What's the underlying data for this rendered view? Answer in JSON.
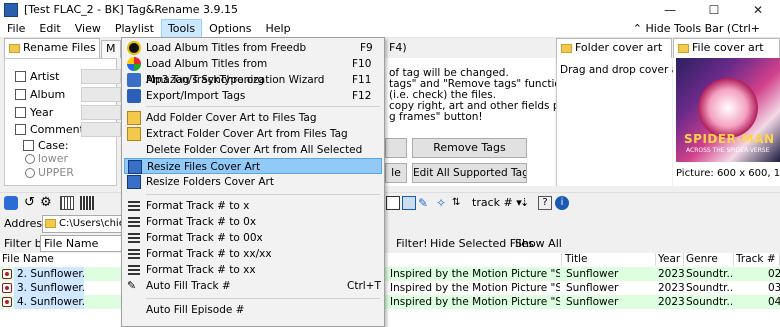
{
  "window": {
    "title": "[Test FLAC_2 - BK] Tag&Rename 3.9.15",
    "minimize": "—",
    "maximize": "☐",
    "close": "✕"
  },
  "menubar": {
    "items": [
      "File",
      "Edit",
      "View",
      "Playlist",
      "Tools",
      "Options",
      "Help"
    ],
    "hide_toolbars": "Hide Tools Bar (Ctrl+"
  },
  "tabs": {
    "rename_files": "Rename Files (F4)",
    "tab2": "M",
    "tab3": "F4)",
    "folder_cover": "Folder cover art",
    "file_cover": "File cover art"
  },
  "left_panel": {
    "artist": "Artist",
    "album": "Album",
    "year": "Year",
    "comment": "Comment",
    "case": "Case:",
    "lower": "lower",
    "upper": "UPPER"
  },
  "middle": {
    "line1": "of tag will be changed.",
    "line2": "tags\" and \"Remove tags\" functions,",
    "line3": "(i.e. check) the files.",
    "line4": "copy right, art and other fields press",
    "line5": "g frames\" button!",
    "remove_tags": "Remove Tags",
    "edit_fields": "Edit All Supported Tag Fields",
    "btn_le": "le"
  },
  "folder_cover": {
    "text": "Drag and drop cover art her"
  },
  "file_cover": {
    "title": "SPIDER-MAN",
    "subtitle": "ACROSS THE SPIDER-VERSE",
    "info": "Picture: 600 x 600, 107 Kb"
  },
  "toolbar": {
    "track_dropdown": "track # ▾"
  },
  "address": {
    "label": "Address:",
    "value": "C:\\Users\\chien\\"
  },
  "filter": {
    "filter_by": "Filter by",
    "file_name": "File Name",
    "filter_btn": "Filter!",
    "hide_selected": "Hide Selected Files",
    "show_all": "Show All"
  },
  "file_list": {
    "headers": {
      "file_name": "File Name",
      "title": "Title",
      "year": "Year",
      "genre": "Genre",
      "track": "Track #"
    },
    "rows": [
      {
        "name": "2. Sunflower.flac",
        "album": "Inspired by the Motion Picture \"Spider-...",
        "title": "Sunflower",
        "year": "2023",
        "genre": "Soundtr...",
        "track": "02"
      },
      {
        "name": "3. Sunflower.flac",
        "album": "Inspired by the Motion Picture \"Spider-...",
        "title": "Sunflower",
        "year": "2023",
        "genre": "Soundtr...",
        "track": "03"
      },
      {
        "name": "4. Sunflower.flac",
        "album": "Inspired by the Motion Picture \"Spider-...",
        "title": "Sunflower",
        "year": "2023",
        "genre": "Soundtr...",
        "track": "04"
      }
    ]
  },
  "tools_menu": {
    "items": [
      {
        "label": "Load Album Titles from Freedb",
        "shortcut": "F9"
      },
      {
        "label": "Load Album Titles from Amazon/TrackType.org",
        "shortcut": "F10"
      },
      {
        "label": "Mp3 Tag's Synchronization Wizard",
        "shortcut": "F11"
      },
      {
        "label": "Export/Import Tags",
        "shortcut": "F12"
      },
      {
        "label": "Add Folder Cover Art to Files Tag",
        "shortcut": ""
      },
      {
        "label": "Extract Folder Cover Art from Files Tag",
        "shortcut": ""
      },
      {
        "label": "Delete Folder Cover Art from All Selected Folders",
        "shortcut": ""
      },
      {
        "label": "Resize Files Cover Art",
        "shortcut": ""
      },
      {
        "label": "Resize Folders Cover Art",
        "shortcut": ""
      },
      {
        "label": "Format Track # to x",
        "shortcut": ""
      },
      {
        "label": "Format Track # to 0x",
        "shortcut": ""
      },
      {
        "label": "Format Track # to 00x",
        "shortcut": ""
      },
      {
        "label": "Format Track # to xx/xx",
        "shortcut": ""
      },
      {
        "label": "Format Track # to xx",
        "shortcut": ""
      },
      {
        "label": "Auto Fill Track #",
        "shortcut": "Ctrl+T"
      },
      {
        "label": "Auto Fill Episode #",
        "shortcut": ""
      }
    ]
  }
}
